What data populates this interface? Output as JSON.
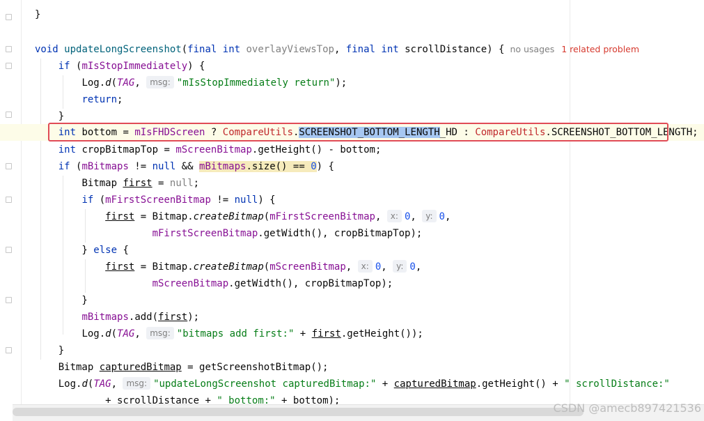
{
  "editor": {
    "inlay": {
      "usages": "no usages",
      "problem": "1 related problem"
    },
    "hints": {
      "msg": "msg:",
      "x": "x:",
      "y": "y:"
    },
    "lines": {
      "l0": "}",
      "sig_void": "void",
      "sig_name": "updateLongScreenshot",
      "sig_final1": "final",
      "sig_int1": "int",
      "sig_p1": "overlayViewsTop",
      "sig_final2": "final",
      "sig_int2": "int",
      "sig_p2": "scrollDistance",
      "if1_kw": "if",
      "if1_fld": "mIsStopImmediately",
      "log1_cls": "Log.",
      "log1_m": "d",
      "tag": "TAG",
      "log1_str": "\"mIsStopImmediately return\"",
      "return_kw": "return",
      "int_kw": "int",
      "bottom_var": "bottom",
      "fhd_fld": "mIsFHDScreen",
      "compare1": "CompareUtils",
      "sel_const": "SCREENSHOT_BOTTOM_LENGTH",
      "hd_suffix": "_HD",
      "compare2": "CompareUtils",
      "const2": "SCREENSHOT_BOTTOM_LENGTH",
      "crop_var": "cropBitmapTop",
      "screen_fld": "mScreenBitmap",
      "getheight": "getHeight",
      "if2_kw": "if",
      "bitmaps_fld": "mBitmaps",
      "null_kw": "null",
      "size_m": "size",
      "zero": "0",
      "bitmap_type": "Bitmap",
      "first_var": "first",
      "if3_kw": "if",
      "firstscreen_fld": "mFirstScreenBitmap",
      "create_m": "createBitmap",
      "getwidth": "getWidth",
      "else_kw": "else",
      "add_m": "add",
      "log2_str": "\"bitmaps add first:\"",
      "captured_var": "capturedBitmap",
      "getss": "getScreenshotBitmap",
      "log3_str": "\"updateLongScreenshot capturedBitmap:\"",
      "log3_str2": "\" scrollDistance:\"",
      "scroll_var": "scrollDistance",
      "log4_str": "\" bottom:\""
    }
  },
  "watermark": "CSDN @amecb897421536",
  "colors": {
    "keyword": "#0033b3",
    "field": "#871094",
    "method": "#00627a",
    "string": "#067d17",
    "error": "#c0282b",
    "highlight_box": "#e04b56",
    "selection": "#a6c7f2"
  }
}
